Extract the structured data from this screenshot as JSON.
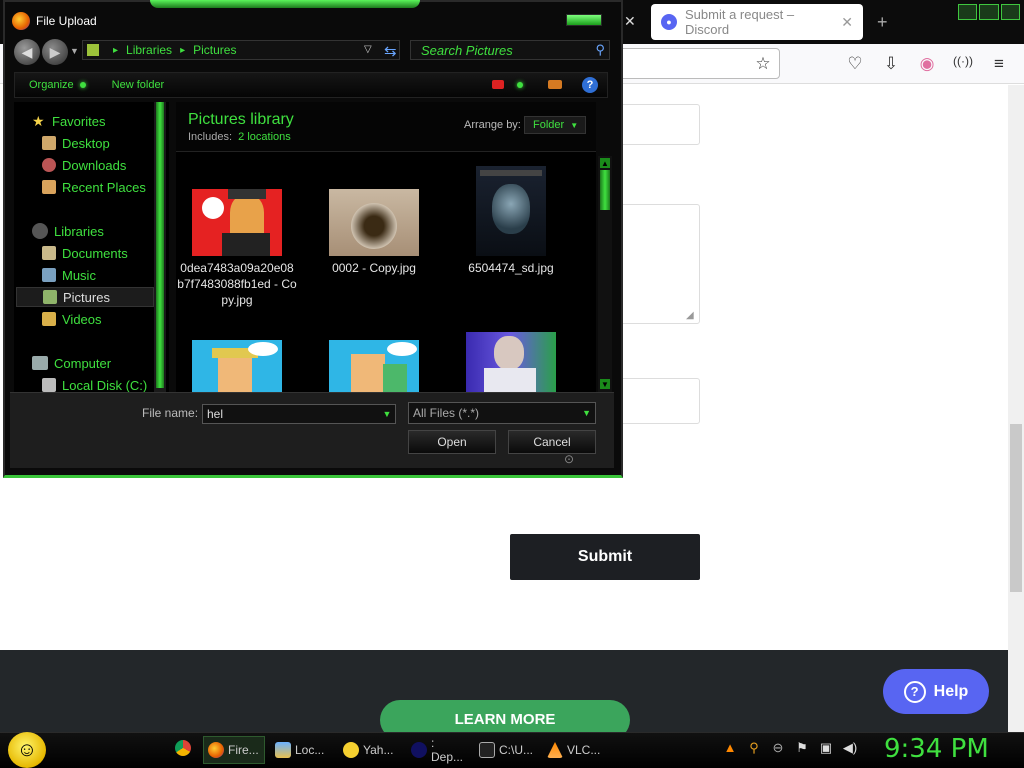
{
  "browser": {
    "tab_title": "Submit a request – Discord",
    "tab_close": "✕",
    "new_tab": "+",
    "close_x": "✕"
  },
  "page": {
    "submit_label": "Submit",
    "learn_more_label": "LEARN MORE",
    "help_label": "Help"
  },
  "dialog": {
    "title": "File Upload",
    "breadcrumb": [
      "Libraries",
      "Pictures"
    ],
    "search_placeholder": "Search Pictures",
    "toolbar": {
      "organize": "Organize",
      "new_folder": "New folder"
    },
    "nav": {
      "favorites": "Favorites",
      "desktop": "Desktop",
      "downloads": "Downloads",
      "recent": "Recent Places",
      "libraries": "Libraries",
      "documents": "Documents",
      "music": "Music",
      "pictures": "Pictures",
      "videos": "Videos",
      "computer": "Computer",
      "local_disk": "Local Disk (C:)"
    },
    "library": {
      "title": "Pictures library",
      "includes_label": "Includes:",
      "includes_value": "2 locations",
      "arrange_label": "Arrange by:",
      "arrange_value": "Folder"
    },
    "files": [
      {
        "name": "0dea7483a09a20e08b7f7483088fb1ed - Copy.jpg"
      },
      {
        "name": "0002 - Copy.jpg"
      },
      {
        "name": "6504474_sd.jpg"
      }
    ],
    "file_name_label": "File name:",
    "file_name_value": "hel",
    "file_type": "All Files (*.*)",
    "open_label": "Open",
    "cancel_label": "Cancel"
  },
  "taskbar": {
    "items": [
      {
        "label": "Fire..."
      },
      {
        "label": "Loc..."
      },
      {
        "label": "Yah..."
      },
      {
        "label": ": Dep..."
      },
      {
        "label": "C:\\U..."
      },
      {
        "label": "VLC..."
      }
    ],
    "clock": "9:34 PM"
  }
}
